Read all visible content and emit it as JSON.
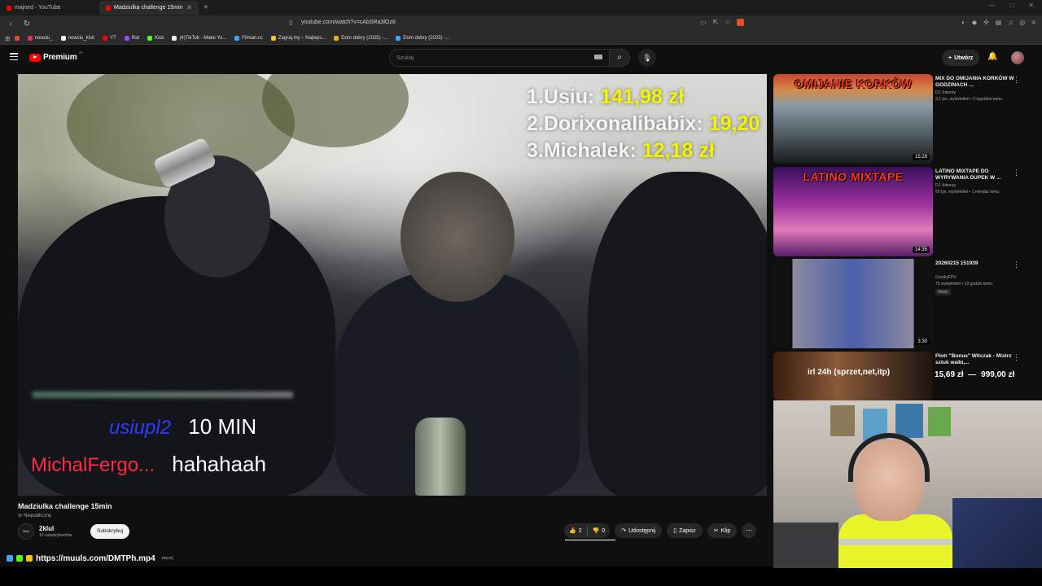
{
  "browser": {
    "tabs": [
      {
        "title": "majned - YouTube",
        "active": false
      },
      {
        "title": "Madziulka challenge 15min",
        "active": true
      }
    ],
    "url": "youtube.com/watch?v=cAbSRa3lOz8",
    "bookmarks": [
      {
        "label": "nowciu_",
        "color": "#e1306c"
      },
      {
        "label": "nowciu_kick",
        "color": "#ffffff"
      },
      {
        "label": "YT",
        "color": "#ff0000"
      },
      {
        "label": "Rat",
        "color": "#9146ff"
      },
      {
        "label": "Kick",
        "color": "#53fc18"
      },
      {
        "label": "(4)TikTok - Make Yo...",
        "color": "#ffffff"
      },
      {
        "label": "Filman.cc",
        "color": "#3ea6ff"
      },
      {
        "label": "Zagraj.my – Najleps...",
        "color": "#f5c518"
      },
      {
        "label": "Dom dobry (2025) -...",
        "color": "#f5a623"
      },
      {
        "label": "Dom dobry (2025) -...",
        "color": "#3ea6ff"
      }
    ]
  },
  "youtube": {
    "logo": "Premium",
    "logo_region": "PL",
    "search_placeholder": "Szukaj",
    "create_label": "Utwórz",
    "accent": "#ff0000"
  },
  "video": {
    "leaderboard": [
      {
        "name": "1.Usiu:",
        "value": "141,98 zł"
      },
      {
        "name": "2.Dorixonalibabix:",
        "value": "19,20"
      },
      {
        "name": "3.Michalek:",
        "value": "12,18 zł"
      }
    ],
    "chat": [
      {
        "user": "usiupl2",
        "message": "10 MIN"
      },
      {
        "user": "MichalFergo...",
        "message": "hahahaah"
      }
    ],
    "title": "Madziulka challenge 15min",
    "visibility": "Niepubliczny",
    "channel": {
      "avatar_text": "2klul",
      "name": "2klul",
      "subs": "13 subskrybentów",
      "subscribe_label": "Subskrybuj"
    },
    "actions": {
      "likes": "2",
      "dislikes": "0",
      "share": "Udostępnij",
      "save": "Zapisz",
      "clip": "Klip"
    },
    "description_link": "https://muuls.com/DMTPh.mp4",
    "description_more": "więcej"
  },
  "sidebar": [
    {
      "title": "MIX DO OMIJANIA KORKÓW W GODZINACH ...",
      "channel": "DJ Jokerey",
      "meta": "3,1 tys. wyświetleń • 2 tygodnie temu",
      "duration": "15:28",
      "thumb_text": "OMIJANIE KORKÓW",
      "badge": ""
    },
    {
      "title": "LATINO MIXTAPE DO WYRYWANIA DUPEK W ...",
      "channel": "DJ Jokerey",
      "meta": "55 tys. wyświetleń • 1 miesiąc temu",
      "duration": "14:35",
      "thumb_text": "LATINO MIXTAPE",
      "badge": ""
    },
    {
      "title": "20260215 151939",
      "channel": "GorskyFPV",
      "meta": "75 wyświetleń • 13 godzin temu",
      "duration": "3:30",
      "thumb_text": "",
      "badge": "Nowy"
    },
    {
      "title": "Piotr \"Bonus\" Witczak - Mistrz sztuk walki,...",
      "channel": "",
      "meta": "",
      "duration": "",
      "thumb_text": "",
      "badge": ""
    }
  ],
  "overlay": {
    "item": "irl 24h (sprzet,net,itp)",
    "progress": "15,69 zł",
    "goal": "999,00 zł"
  }
}
